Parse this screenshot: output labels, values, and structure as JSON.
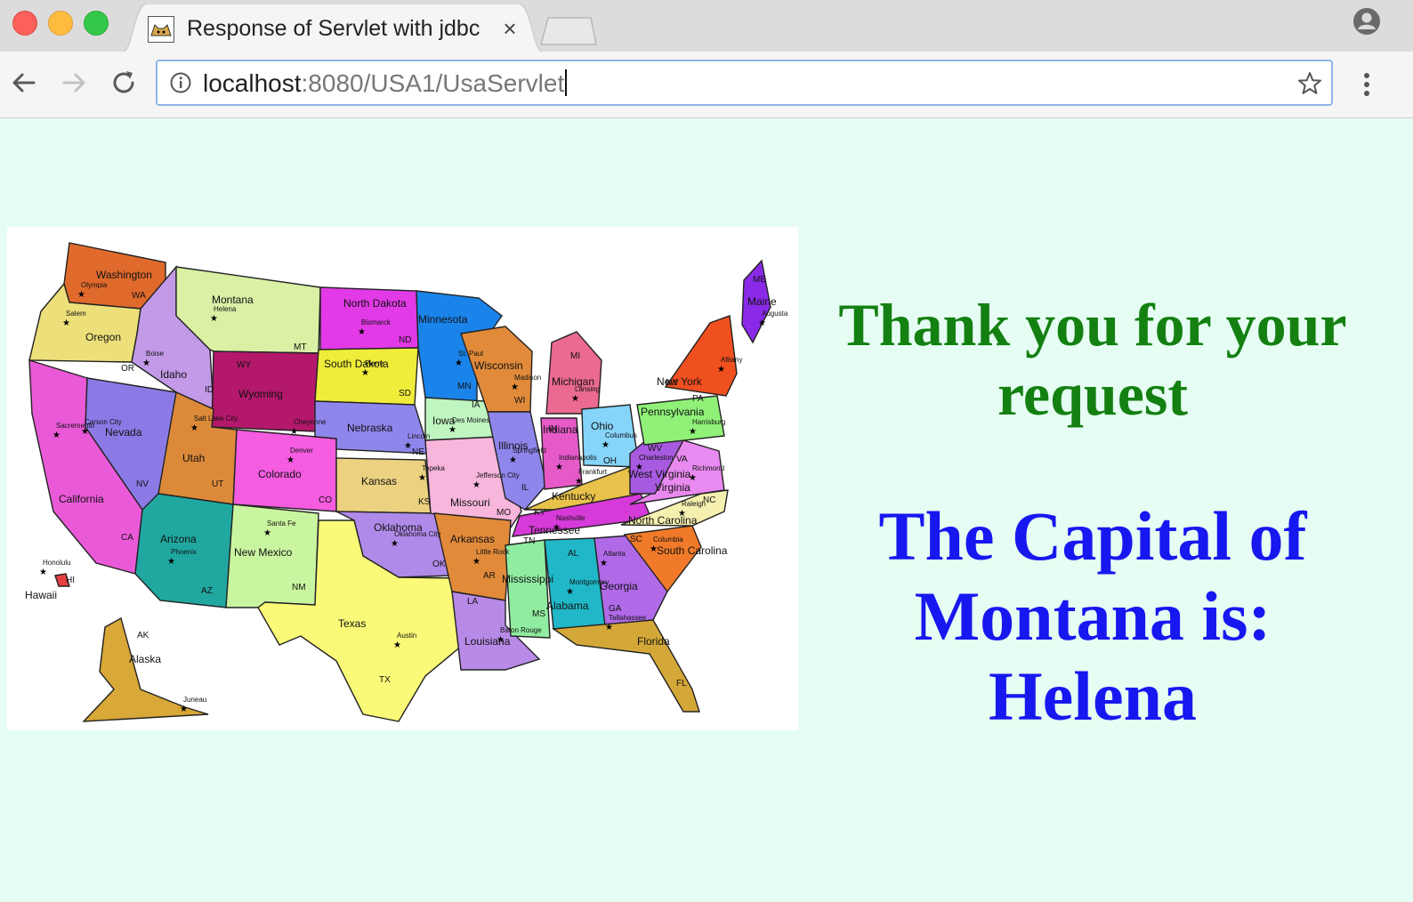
{
  "browser": {
    "tab": {
      "title": "Response of Servlet with jdbc",
      "close_glyph": "×",
      "favicon": "tomcat-icon"
    },
    "address": {
      "host": "localhost",
      "path": ":8080/USA1/UsaServlet"
    },
    "colors": {
      "omnibox_border": "#8fb4e8",
      "tabbar": "#dcdcdc",
      "toolbar": "#f5f5f5"
    }
  },
  "page": {
    "background": "#e6fdf3",
    "thanks": "Thank you for your request",
    "capital": "The Capital of Montana is: Helena",
    "colors": {
      "thanks": "#138011",
      "capital": "#1717f0"
    },
    "map": {
      "states": [
        {
          "name": "Washington",
          "abbr": "WA",
          "capital": "Olympia",
          "color": "#e06a2c"
        },
        {
          "name": "Oregon",
          "abbr": "OR",
          "capital": "Salem",
          "color": "#ede07a"
        },
        {
          "name": "California",
          "abbr": "CA",
          "capital": "Sacremento",
          "color": "#ea5ad8"
        },
        {
          "name": "Nevada",
          "abbr": "NV",
          "capital": "Carson City",
          "color": "#8b7ae6"
        },
        {
          "name": "Idaho",
          "abbr": "ID",
          "capital": "Boise",
          "color": "#c39ae8"
        },
        {
          "name": "Montana",
          "abbr": "MT",
          "capital": "Helena",
          "color": "#d9f0a5"
        },
        {
          "name": "Wyoming",
          "abbr": "WY",
          "capital": "Cheyenne",
          "color": "#b3186b"
        },
        {
          "name": "Utah",
          "abbr": "UT",
          "capital": "Salt Lake City",
          "color": "#dc8a3a"
        },
        {
          "name": "Arizona",
          "abbr": "AZ",
          "capital": "Phoenix",
          "color": "#20a8a0"
        },
        {
          "name": "Colorado",
          "abbr": "CO",
          "capital": "Denver",
          "color": "#f55ce0"
        },
        {
          "name": "New Mexico",
          "abbr": "NM",
          "capital": "Santa Fe",
          "color": "#caf5a0"
        },
        {
          "name": "North Dakota",
          "abbr": "ND",
          "capital": "Bismarck",
          "color": "#e23ae6"
        },
        {
          "name": "South Dakota",
          "abbr": "SD",
          "capital": "Pierre",
          "color": "#f0ec3a"
        },
        {
          "name": "Nebraska",
          "abbr": "NE",
          "capital": "Lincoln",
          "color": "#8f86ec"
        },
        {
          "name": "Kansas",
          "abbr": "KS",
          "capital": "Topeka",
          "color": "#ecd280"
        },
        {
          "name": "Oklahoma",
          "abbr": "OK",
          "capital": "Oklahoma City",
          "color": "#b08ae8"
        },
        {
          "name": "Texas",
          "abbr": "TX",
          "capital": "Austin",
          "color": "#fafa78"
        },
        {
          "name": "Minnesota",
          "abbr": "MN",
          "capital": "St. Paul",
          "color": "#1a84ea"
        },
        {
          "name": "Iowa",
          "abbr": "IA",
          "capital": "Des Moines",
          "color": "#bff5c0"
        },
        {
          "name": "Missouri",
          "abbr": "MO",
          "capital": "Jefferson City",
          "color": "#f8b6dc"
        },
        {
          "name": "Arkansas",
          "abbr": "AR",
          "capital": "Little Rock",
          "color": "#e08a3a"
        },
        {
          "name": "Louisiana",
          "abbr": "LA",
          "capital": "Baton Rouge",
          "color": "#b88ae8"
        },
        {
          "name": "Wisconsin",
          "abbr": "WI",
          "capital": "Madison",
          "color": "#e08a3a"
        },
        {
          "name": "Illinois",
          "abbr": "IL",
          "capital": "Springfield",
          "color": "#8f86ec"
        },
        {
          "name": "Michigan",
          "abbr": "MI",
          "capital": "Lansing",
          "color": "#ea6a92"
        },
        {
          "name": "Indiana",
          "abbr": "IN",
          "capital": "Indianapolis",
          "color": "#e65ac8"
        },
        {
          "name": "Ohio",
          "abbr": "OH",
          "capital": "Columbus",
          "color": "#86d4fa"
        },
        {
          "name": "Kentucky",
          "abbr": "KY",
          "capital": "Frankfurt",
          "color": "#e8c24a"
        },
        {
          "name": "Tennessee",
          "abbr": "TN",
          "capital": "Nashville",
          "color": "#d63ad8"
        },
        {
          "name": "Mississippi",
          "abbr": "MS",
          "capital": "",
          "color": "#90eca0"
        },
        {
          "name": "Alabama",
          "abbr": "AL",
          "capital": "Montgomery",
          "color": "#20b8c8"
        },
        {
          "name": "Georgia",
          "abbr": "GA",
          "capital": "Atlanta",
          "color": "#b06ae8"
        },
        {
          "name": "Florida",
          "abbr": "FL",
          "capital": "Tallahassee",
          "color": "#d4a838"
        },
        {
          "name": "South Carolina",
          "abbr": "SC",
          "capital": "Columbia",
          "color": "#f07a2a"
        },
        {
          "name": "North Carolina",
          "abbr": "NC",
          "capital": "Raleigh",
          "color": "#f5f0b0"
        },
        {
          "name": "Virginia",
          "abbr": "VA",
          "capital": "Richmond",
          "color": "#e88af0"
        },
        {
          "name": "West Virginia",
          "abbr": "WV",
          "capital": "Charleston",
          "color": "#a85ae0"
        },
        {
          "name": "Pennsylvania",
          "abbr": "PA",
          "capital": "Harrisburg",
          "color": "#90f078"
        },
        {
          "name": "New York",
          "abbr": "NY",
          "capital": "Albany",
          "color": "#f05020"
        },
        {
          "name": "Maine",
          "abbr": "ME",
          "capital": "Augusta",
          "color": "#8a2ae8"
        },
        {
          "name": "Alaska",
          "abbr": "AK",
          "capital": "Juneau",
          "color": "#d8a838"
        },
        {
          "name": "Hawaii",
          "abbr": "HI",
          "capital": "Honolulu",
          "color": "#e84040"
        }
      ]
    }
  }
}
